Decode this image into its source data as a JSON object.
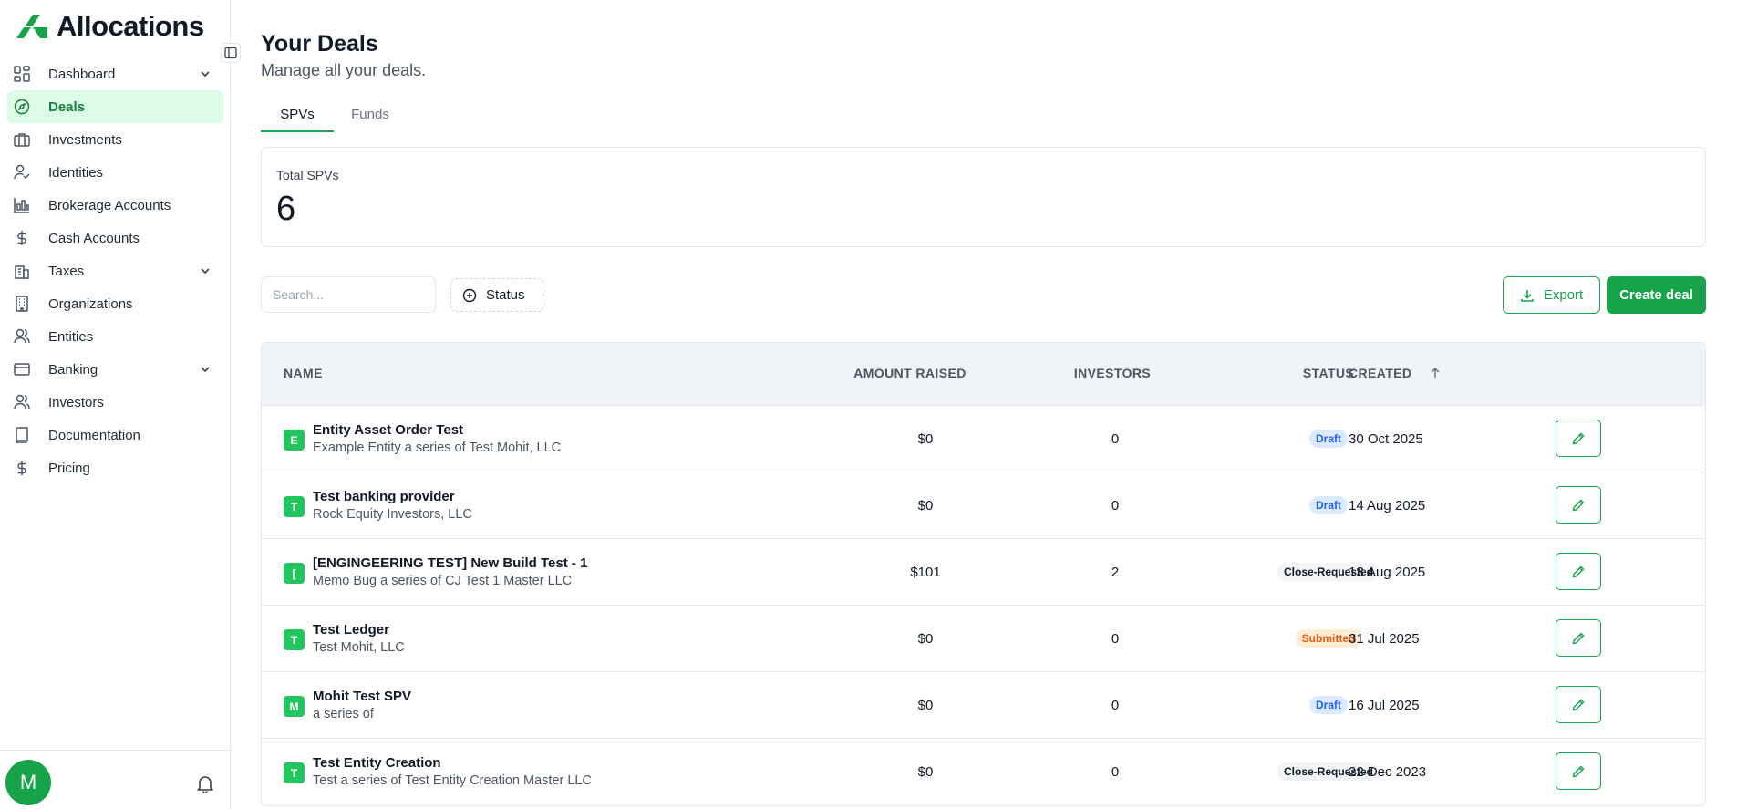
{
  "app": {
    "logo_text": "Allocations",
    "brand_color": "#16a34a"
  },
  "sidebar": {
    "items": [
      {
        "label": "Dashboard",
        "icon": "dashboard-grid-icon",
        "has_chevron": true
      },
      {
        "label": "Deals",
        "icon": "compass-icon",
        "active": true
      },
      {
        "label": "Investments",
        "icon": "briefcase-icon"
      },
      {
        "label": "Identities",
        "icon": "user-check-icon"
      },
      {
        "label": "Brokerage Accounts",
        "icon": "bar-chart-icon"
      },
      {
        "label": "Cash Accounts",
        "icon": "dollar-icon"
      },
      {
        "label": "Taxes",
        "icon": "landmark-icon",
        "has_chevron": true
      },
      {
        "label": "Organizations",
        "icon": "building-icon"
      },
      {
        "label": "Entities",
        "icon": "users-icon"
      },
      {
        "label": "Banking",
        "icon": "credit-card-icon",
        "has_chevron": true
      },
      {
        "label": "Investors",
        "icon": "users-icon"
      },
      {
        "label": "Documentation",
        "icon": "book-icon"
      },
      {
        "label": "Pricing",
        "icon": "dollar-icon"
      }
    ],
    "avatar_initial": "M"
  },
  "page": {
    "title": "Your Deals",
    "subtitle": "Manage all your deals.",
    "tabs": [
      {
        "label": "SPVs",
        "active": true
      },
      {
        "label": "Funds"
      }
    ]
  },
  "stats": {
    "label": "Total SPVs",
    "value": "6"
  },
  "toolbar": {
    "search_placeholder": "Search...",
    "status_filter_label": "Status",
    "export_label": "Export",
    "create_label": "Create deal"
  },
  "table": {
    "headers": {
      "name": "NAME",
      "amount": "AMOUNT RAISED",
      "investors": "INVESTORS",
      "status": "STATUS",
      "created": "CREATED"
    },
    "rows": [
      {
        "letter": "E",
        "name": "Entity Asset Order Test",
        "subtitle": "Example Entity a series of Test Mohit, LLC",
        "amount": "$0",
        "investors": "0",
        "status": "Draft",
        "status_kind": "draft",
        "created": "30 Oct 2025"
      },
      {
        "letter": "T",
        "name": "Test banking provider",
        "subtitle": "Rock Equity Investors, LLC",
        "amount": "$0",
        "investors": "0",
        "status": "Draft",
        "status_kind": "draft",
        "created": "14 Aug 2025"
      },
      {
        "letter": "[",
        "name": "[ENGINGEERING TEST] New Build Test - 1",
        "subtitle": "Memo Bug a series of CJ Test 1 Master LLC",
        "amount": "$101",
        "investors": "2",
        "status": "Close-Requested",
        "status_kind": "close",
        "created": "13 Aug 2025"
      },
      {
        "letter": "T",
        "name": "Test Ledger",
        "subtitle": "Test Mohit, LLC",
        "amount": "$0",
        "investors": "0",
        "status": "Submitted",
        "status_kind": "submitted",
        "created": "31 Jul 2025"
      },
      {
        "letter": "M",
        "name": "Mohit Test SPV",
        "subtitle": "a series of",
        "amount": "$0",
        "investors": "0",
        "status": "Draft",
        "status_kind": "draft",
        "created": "16 Jul 2025"
      },
      {
        "letter": "T",
        "name": "Test Entity Creation",
        "subtitle": "Test a series of Test Entity Creation Master LLC",
        "amount": "$0",
        "investors": "0",
        "status": "Close-Requested",
        "status_kind": "close",
        "created": "22 Dec 2023"
      }
    ]
  }
}
